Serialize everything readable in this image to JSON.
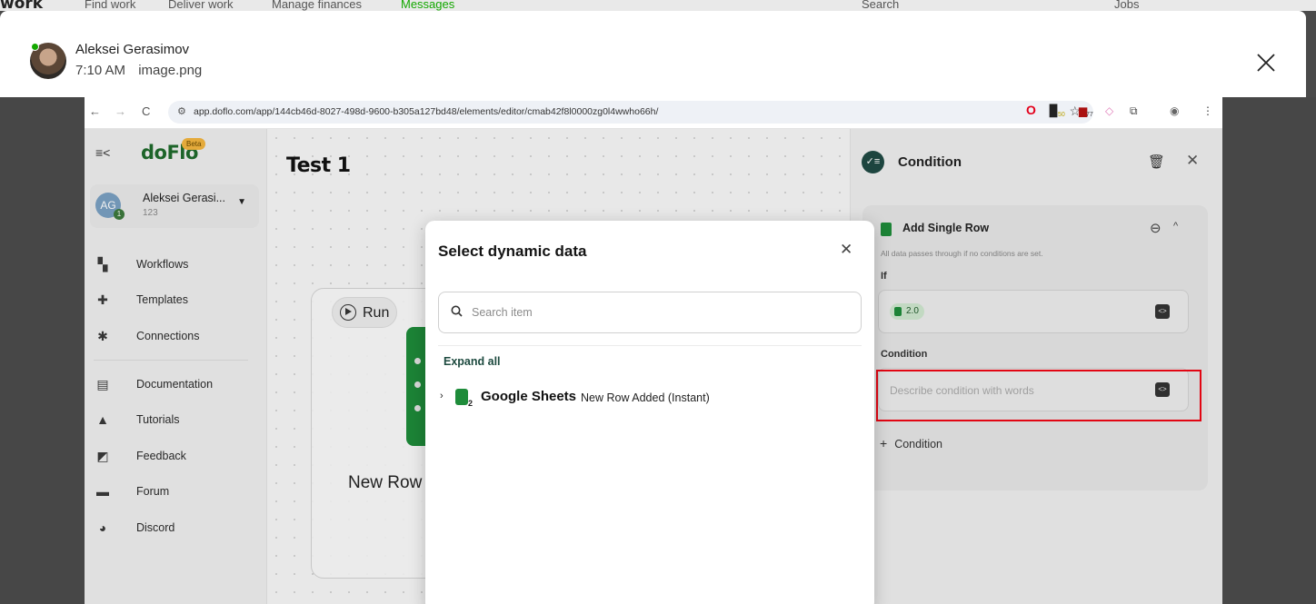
{
  "background": {
    "logo": "work",
    "nav": [
      "Find work",
      "Deliver work",
      "Manage finances",
      "Messages"
    ],
    "search_placeholder": "Search",
    "jobs_label": "Jobs"
  },
  "lightbox": {
    "sender": "Aleksei Gerasimov",
    "time": "7:10 AM",
    "filename": "image.png",
    "close_glyph": "✕"
  },
  "browser": {
    "back": "←",
    "forward": "→",
    "reload": "C",
    "url": "app.doflo.com/app/144cb46d-8027-498d-9600-b305a127bd48/elements/editor/cmab42f8l0000zg0l4wwho66h/",
    "ext_badge_1": "50",
    "ext_badge_2": "77"
  },
  "sidebar": {
    "logo": "doFlo",
    "beta": "Beta",
    "user": {
      "initials": "AG",
      "badge": "1",
      "name": "Aleksei Gerasi...",
      "id": "123"
    },
    "items": [
      {
        "label": "Workflows",
        "icon": "workflow-icon"
      },
      {
        "label": "Templates",
        "icon": "puzzle-icon"
      },
      {
        "label": "Connections",
        "icon": "connections-icon"
      },
      {
        "label": "Documentation",
        "icon": "book-icon"
      },
      {
        "label": "Tutorials",
        "icon": "graduation-cap-icon"
      },
      {
        "label": "Feedback",
        "icon": "feedback-icon"
      },
      {
        "label": "Forum",
        "icon": "forum-icon"
      },
      {
        "label": "Discord",
        "icon": "discord-icon"
      }
    ]
  },
  "canvas": {
    "title": "Test 1",
    "node": {
      "run_label": "Run",
      "label": "New Row"
    }
  },
  "panel": {
    "title": "Condition",
    "card": {
      "heading": "Add Single Row",
      "note": "All data passes through if no conditions are set.",
      "if_label": "If",
      "if_chip": "2.0",
      "condition_label": "Condition",
      "condition_placeholder": "Describe condition with words",
      "add_condition": "Condition"
    }
  },
  "modal": {
    "title": "Select dynamic data",
    "search_placeholder": "Search item",
    "expand_all": "Expand all",
    "rows": [
      {
        "step": "2",
        "app": "Google Sheets",
        "trigger": "New Row Added (Instant)"
      }
    ]
  },
  "colors": {
    "brand_green": "#1e8c3a",
    "highlight_red": "#e20613",
    "upwork_green": "#14a800"
  }
}
